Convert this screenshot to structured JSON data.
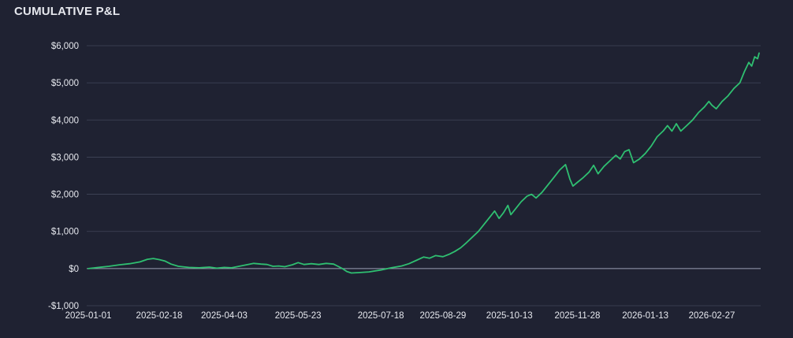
{
  "panel": {
    "title": "CUMULATIVE P&L"
  },
  "colors": {
    "background": "#1f2232",
    "grid": "#41465a",
    "zero_line": "#9aa0b4",
    "axis_text": "#e6e8ee",
    "line": "#2fbf71"
  },
  "chart_data": {
    "type": "line",
    "title": "",
    "xlabel": "",
    "ylabel": "",
    "ylim": [
      -1000,
      6000
    ],
    "xlim": [
      "2025-01-01",
      "2026-03-31"
    ],
    "grid": true,
    "y_ticks": [
      -1000,
      0,
      1000,
      2000,
      3000,
      4000,
      5000,
      6000
    ],
    "y_tick_labels": [
      "-$1,000",
      "$0",
      "$1,000",
      "$2,000",
      "$3,000",
      "$4,000",
      "$5,000",
      "$6,000"
    ],
    "x_ticks": [
      "2025-01-01",
      "2025-02-18",
      "2025-04-03",
      "2025-05-23",
      "2025-07-18",
      "2025-08-29",
      "2025-10-13",
      "2025-11-28",
      "2026-01-13",
      "2026-02-27"
    ],
    "series": [
      {
        "values": [
          [
            "2025-01-01",
            0
          ],
          [
            "2025-01-08",
            30
          ],
          [
            "2025-01-15",
            60
          ],
          [
            "2025-01-22",
            100
          ],
          [
            "2025-01-29",
            130
          ],
          [
            "2025-02-05",
            180
          ],
          [
            "2025-02-10",
            250
          ],
          [
            "2025-02-14",
            270
          ],
          [
            "2025-02-18",
            240
          ],
          [
            "2025-02-22",
            200
          ],
          [
            "2025-02-26",
            120
          ],
          [
            "2025-03-03",
            60
          ],
          [
            "2025-03-10",
            30
          ],
          [
            "2025-03-17",
            20
          ],
          [
            "2025-03-24",
            40
          ],
          [
            "2025-03-29",
            10
          ],
          [
            "2025-04-03",
            30
          ],
          [
            "2025-04-08",
            20
          ],
          [
            "2025-04-13",
            60
          ],
          [
            "2025-04-18",
            100
          ],
          [
            "2025-04-23",
            140
          ],
          [
            "2025-04-28",
            120
          ],
          [
            "2025-05-02",
            110
          ],
          [
            "2025-05-06",
            60
          ],
          [
            "2025-05-10",
            70
          ],
          [
            "2025-05-14",
            50
          ],
          [
            "2025-05-19",
            100
          ],
          [
            "2025-05-23",
            160
          ],
          [
            "2025-05-27",
            110
          ],
          [
            "2025-06-01",
            130
          ],
          [
            "2025-06-06",
            110
          ],
          [
            "2025-06-11",
            140
          ],
          [
            "2025-06-16",
            120
          ],
          [
            "2025-06-19",
            60
          ],
          [
            "2025-06-22",
            0
          ],
          [
            "2025-06-25",
            -80
          ],
          [
            "2025-06-28",
            -120
          ],
          [
            "2025-07-03",
            -110
          ],
          [
            "2025-07-10",
            -90
          ],
          [
            "2025-07-18",
            -40
          ],
          [
            "2025-07-25",
            20
          ],
          [
            "2025-08-01",
            70
          ],
          [
            "2025-08-06",
            130
          ],
          [
            "2025-08-11",
            220
          ],
          [
            "2025-08-16",
            310
          ],
          [
            "2025-08-20",
            280
          ],
          [
            "2025-08-24",
            350
          ],
          [
            "2025-08-29",
            320
          ],
          [
            "2025-09-02",
            380
          ],
          [
            "2025-09-06",
            460
          ],
          [
            "2025-09-10",
            560
          ],
          [
            "2025-09-14",
            700
          ],
          [
            "2025-09-18",
            850
          ],
          [
            "2025-09-22",
            1000
          ],
          [
            "2025-09-26",
            1200
          ],
          [
            "2025-09-30",
            1400
          ],
          [
            "2025-10-03",
            1550
          ],
          [
            "2025-10-06",
            1350
          ],
          [
            "2025-10-09",
            1500
          ],
          [
            "2025-10-12",
            1700
          ],
          [
            "2025-10-14",
            1450
          ],
          [
            "2025-10-17",
            1600
          ],
          [
            "2025-10-21",
            1800
          ],
          [
            "2025-10-25",
            1950
          ],
          [
            "2025-10-28",
            2000
          ],
          [
            "2025-10-31",
            1900
          ],
          [
            "2025-11-04",
            2050
          ],
          [
            "2025-11-08",
            2250
          ],
          [
            "2025-11-12",
            2450
          ],
          [
            "2025-11-16",
            2650
          ],
          [
            "2025-11-20",
            2800
          ],
          [
            "2025-11-23",
            2400
          ],
          [
            "2025-11-25",
            2220
          ],
          [
            "2025-11-28",
            2320
          ],
          [
            "2025-12-02",
            2450
          ],
          [
            "2025-12-06",
            2600
          ],
          [
            "2025-12-09",
            2780
          ],
          [
            "2025-12-12",
            2550
          ],
          [
            "2025-12-16",
            2750
          ],
          [
            "2025-12-20",
            2900
          ],
          [
            "2025-12-24",
            3050
          ],
          [
            "2025-12-27",
            2950
          ],
          [
            "2025-12-30",
            3150
          ],
          [
            "2026-01-02",
            3200
          ],
          [
            "2026-01-05",
            2850
          ],
          [
            "2026-01-09",
            2950
          ],
          [
            "2026-01-13",
            3100
          ],
          [
            "2026-01-17",
            3300
          ],
          [
            "2026-01-21",
            3550
          ],
          [
            "2026-01-25",
            3700
          ],
          [
            "2026-01-28",
            3850
          ],
          [
            "2026-01-31",
            3700
          ],
          [
            "2026-02-03",
            3900
          ],
          [
            "2026-02-06",
            3700
          ],
          [
            "2026-02-10",
            3850
          ],
          [
            "2026-02-14",
            4000
          ],
          [
            "2026-02-18",
            4200
          ],
          [
            "2026-02-22",
            4350
          ],
          [
            "2026-02-25",
            4500
          ],
          [
            "2026-02-27",
            4400
          ],
          [
            "2026-03-02",
            4300
          ],
          [
            "2026-03-06",
            4500
          ],
          [
            "2026-03-10",
            4650
          ],
          [
            "2026-03-14",
            4850
          ],
          [
            "2026-03-18",
            5000
          ],
          [
            "2026-03-21",
            5300
          ],
          [
            "2026-03-24",
            5550
          ],
          [
            "2026-03-26",
            5450
          ],
          [
            "2026-03-28",
            5700
          ],
          [
            "2026-03-30",
            5650
          ],
          [
            "2026-03-31",
            5800
          ]
        ]
      }
    ]
  }
}
